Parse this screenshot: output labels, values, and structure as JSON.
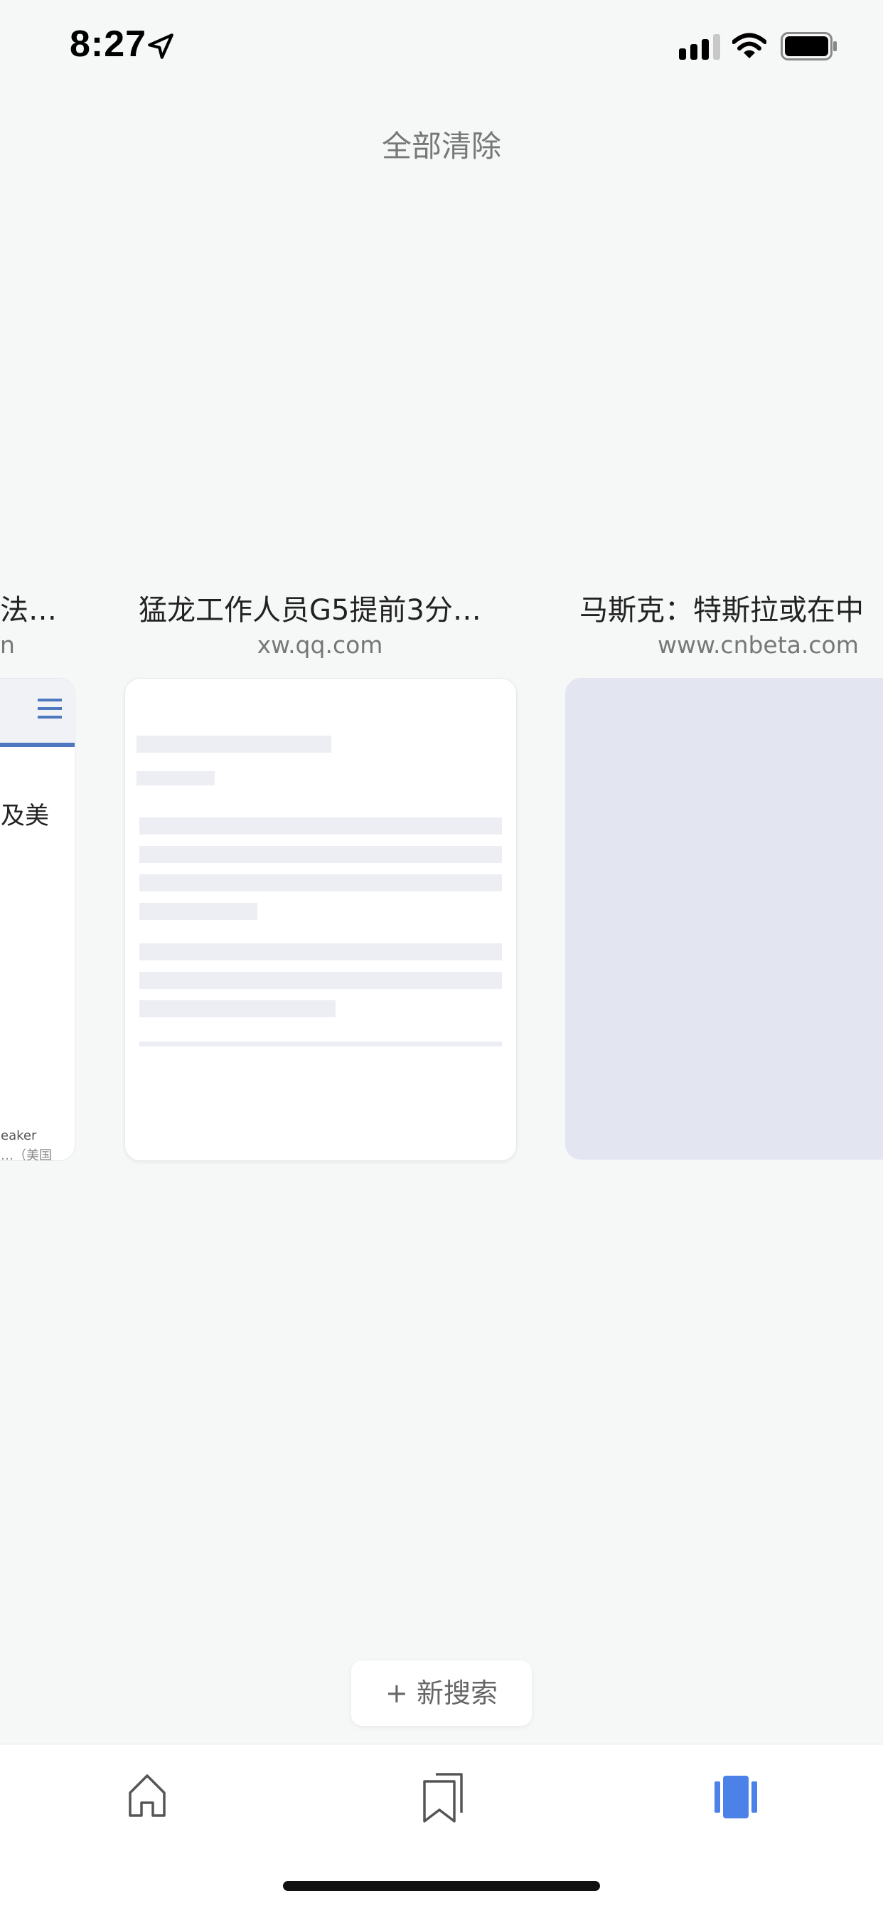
{
  "status_bar": {
    "time": "8:27"
  },
  "header": {
    "clear_all_label": "全部清除"
  },
  "tabs": [
    {
      "title": "法…",
      "domain": "n",
      "preview_text": "及美",
      "footer_lines": [
        "eaker",
        "…（美国"
      ]
    },
    {
      "title": "猛龙工作人员G5提前3分…",
      "domain": "xw.qq.com"
    },
    {
      "title": "马斯克：特斯拉或在中",
      "domain": "www.cnbeta.com"
    }
  ],
  "actions": {
    "new_search_label": "+ 新搜索"
  },
  "bottom_nav": {
    "items": [
      {
        "name": "home",
        "icon": "home-icon"
      },
      {
        "name": "bookmarks",
        "icon": "bookmarks-icon"
      },
      {
        "name": "tabs",
        "icon": "tabs-icon",
        "active": true
      }
    ]
  },
  "colors": {
    "accent": "#4c82e8",
    "background": "#f6f7f7"
  }
}
